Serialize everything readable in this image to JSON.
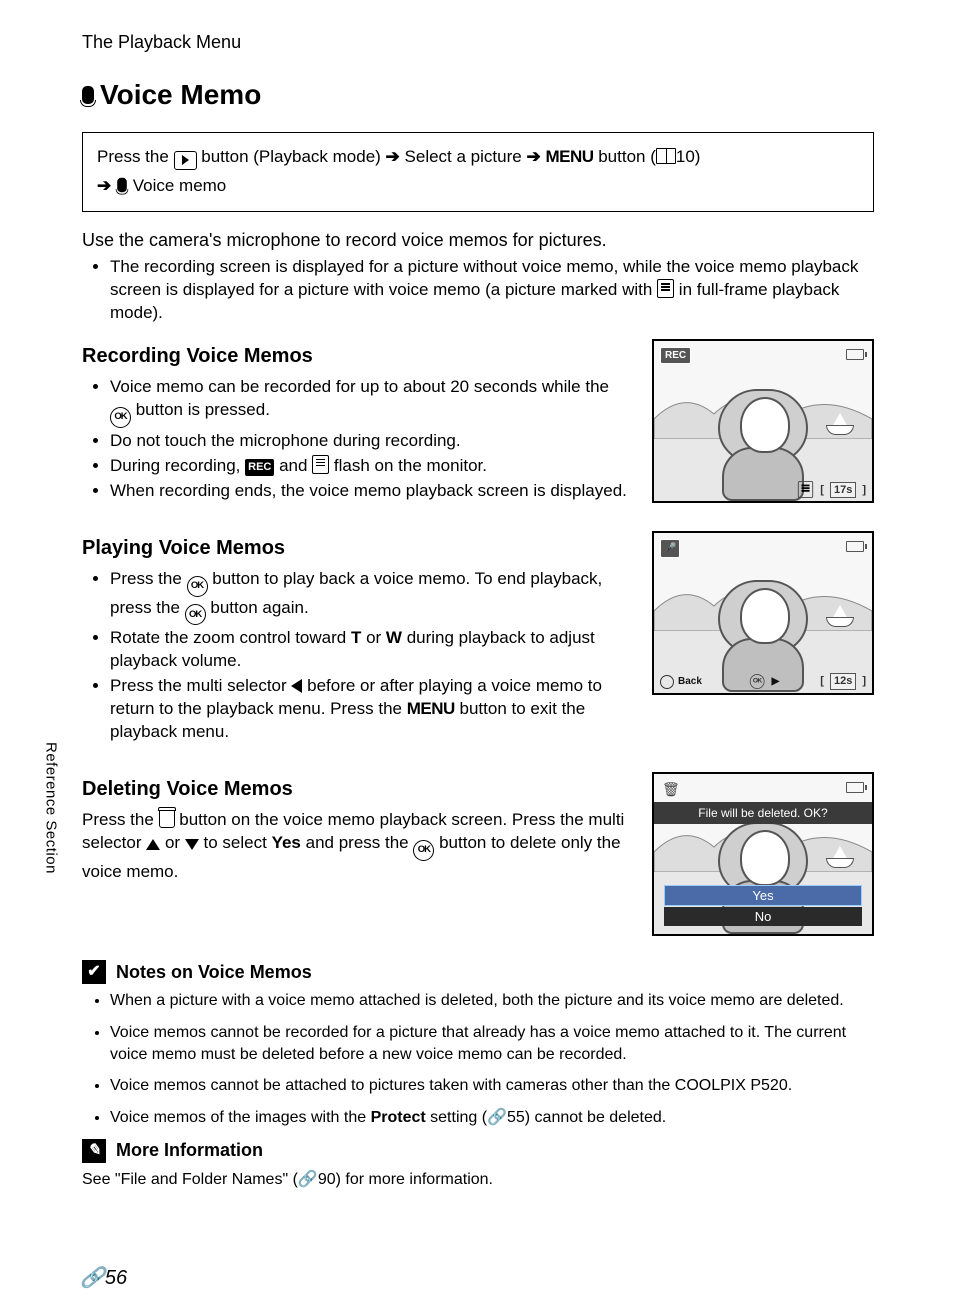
{
  "header": {
    "breadcrumb": "The Playback Menu"
  },
  "title": "Voice Memo",
  "nav": {
    "press_the": "Press the",
    "playback_mode": " button (Playback mode)",
    "select_picture": "Select a picture",
    "menu_word": "MENU",
    "button_word": " button (",
    "ref10": "10)",
    "voice_memo": "Voice memo"
  },
  "intro": "Use the camera's microphone to record voice memos for pictures.",
  "intro_bullet_a": "The recording screen is displayed for a picture without voice memo, while the voice memo playback screen is displayed for a picture with voice memo (a picture marked with ",
  "intro_bullet_b": " in full-frame playback mode).",
  "recording": {
    "heading": "Recording Voice Memos",
    "b1a": "Voice memo can be recorded for up to about 20 seconds while the ",
    "b1b": " button is pressed.",
    "b2": "Do not touch the microphone during recording.",
    "b3a": "During recording, ",
    "b3b": " and ",
    "b3c": " flash on the monitor.",
    "b4": "When recording ends, the voice memo playback screen is displayed.",
    "screen": {
      "rec_badge": "REC",
      "time": "17s"
    }
  },
  "playing": {
    "heading": "Playing Voice Memos",
    "b1a": "Press the ",
    "b1b": " button to play back a voice memo. To end playback, press the ",
    "b1c": " button again.",
    "b2a": "Rotate the zoom control toward ",
    "b2_T": "T",
    "b2b": " or ",
    "b2_W": "W",
    "b2c": " during playback to adjust playback volume.",
    "b3a": "Press the multi selector ",
    "b3b": " before or after playing a voice memo to return to the playback menu. Press the ",
    "b3c": " button to exit the playback menu.",
    "screen": {
      "back": "Back",
      "time": "12s"
    }
  },
  "deleting": {
    "heading": "Deleting Voice Memos",
    "p1a": "Press the ",
    "p1b": " button on the voice memo playback screen. Press the multi selector ",
    "p1c": " or ",
    "p1d": " to select ",
    "yes": "Yes",
    "p1e": " and press the ",
    "p1f": " button to delete only the voice memo.",
    "screen": {
      "confirm": "File will be deleted. OK?",
      "opt_yes": "Yes",
      "opt_no": "No"
    }
  },
  "notes": {
    "heading": "Notes on Voice Memos",
    "n1": "When a picture with a voice memo attached is deleted, both the picture and its voice memo are deleted.",
    "n2": "Voice memos cannot be recorded for a picture that already has a voice memo attached to it. The current voice memo must be deleted before a new voice memo can be recorded.",
    "n3": "Voice memos cannot be attached to pictures taken with cameras other than the COOLPIX P520.",
    "n4a": "Voice memos of the images with the ",
    "n4_protect": "Protect",
    "n4b": " setting (",
    "n4_ref": "55) cannot be deleted."
  },
  "more": {
    "heading": "More Information",
    "text_a": "See \"File and Folder Names\" (",
    "ref": "90) for more information."
  },
  "side_label": "Reference Section",
  "page_number": "56",
  "glyphs": {
    "arrow": "➔",
    "ok": "OK",
    "rec": "REC",
    "menu": "MENU",
    "link": "E"
  }
}
